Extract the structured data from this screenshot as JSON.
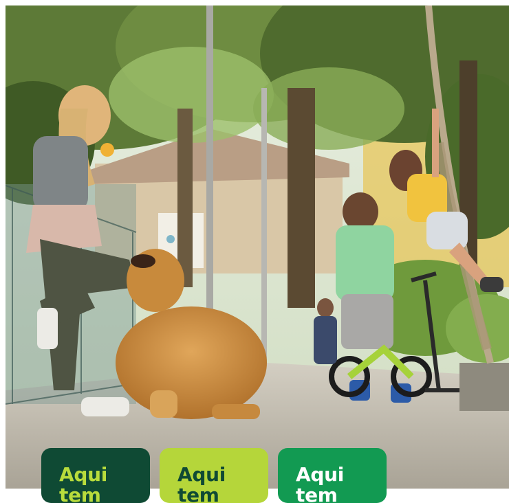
{
  "photo": {
    "alt_subject": "park scene",
    "colors": {
      "foliage_dark": "#4f6b2e",
      "foliage_light": "#9cbf6a",
      "path": "#c2bcae",
      "dog": "#c88a3c",
      "accent_yellow": "#e8c248"
    }
  },
  "cards": [
    {
      "label": "Aqui",
      "sub": "tem",
      "bg": "#0f4a34",
      "fg": "#b8dc3c"
    },
    {
      "label": "Aqui",
      "sub": "tem",
      "bg": "#b5d63a",
      "fg": "#0f4a34"
    },
    {
      "label": "Aqui",
      "sub": "tem",
      "bg": "#129a52",
      "fg": "#ffffff"
    }
  ]
}
